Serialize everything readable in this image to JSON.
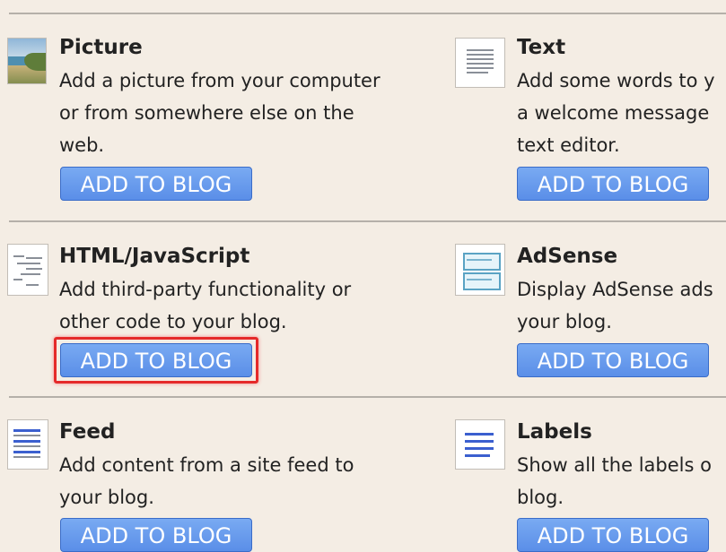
{
  "widgets": [
    {
      "title": "Picture",
      "desc": [
        "Add a picture from your computer",
        "or from somewhere else on the",
        "web."
      ],
      "button": "ADD TO BLOG",
      "icon": "picture-icon"
    },
    {
      "title": "Text",
      "desc": [
        "Add some words to y",
        "a welcome message",
        "text editor."
      ],
      "button": "ADD TO BLOG",
      "icon": "text-icon"
    },
    {
      "title": "HTML/JavaScript",
      "desc": [
        "Add third-party functionality or",
        "other code to your blog."
      ],
      "button": "ADD TO BLOG",
      "icon": "html-javascript-icon"
    },
    {
      "title": "AdSense",
      "desc": [
        "Display AdSense ads",
        "your blog."
      ],
      "button": "ADD TO BLOG",
      "icon": "adsense-icon"
    },
    {
      "title": "Feed",
      "desc": [
        "Add content from a site feed to",
        "your blog."
      ],
      "button": "ADD TO BLOG",
      "icon": "feed-icon"
    },
    {
      "title": "Labels",
      "desc": [
        "Show all the labels o",
        "blog."
      ],
      "button": "ADD TO BLOG",
      "icon": "labels-icon"
    }
  ],
  "colors": {
    "accent": "#5a8ee8",
    "highlight": "#e52a2a",
    "background": "#f4ede4"
  }
}
